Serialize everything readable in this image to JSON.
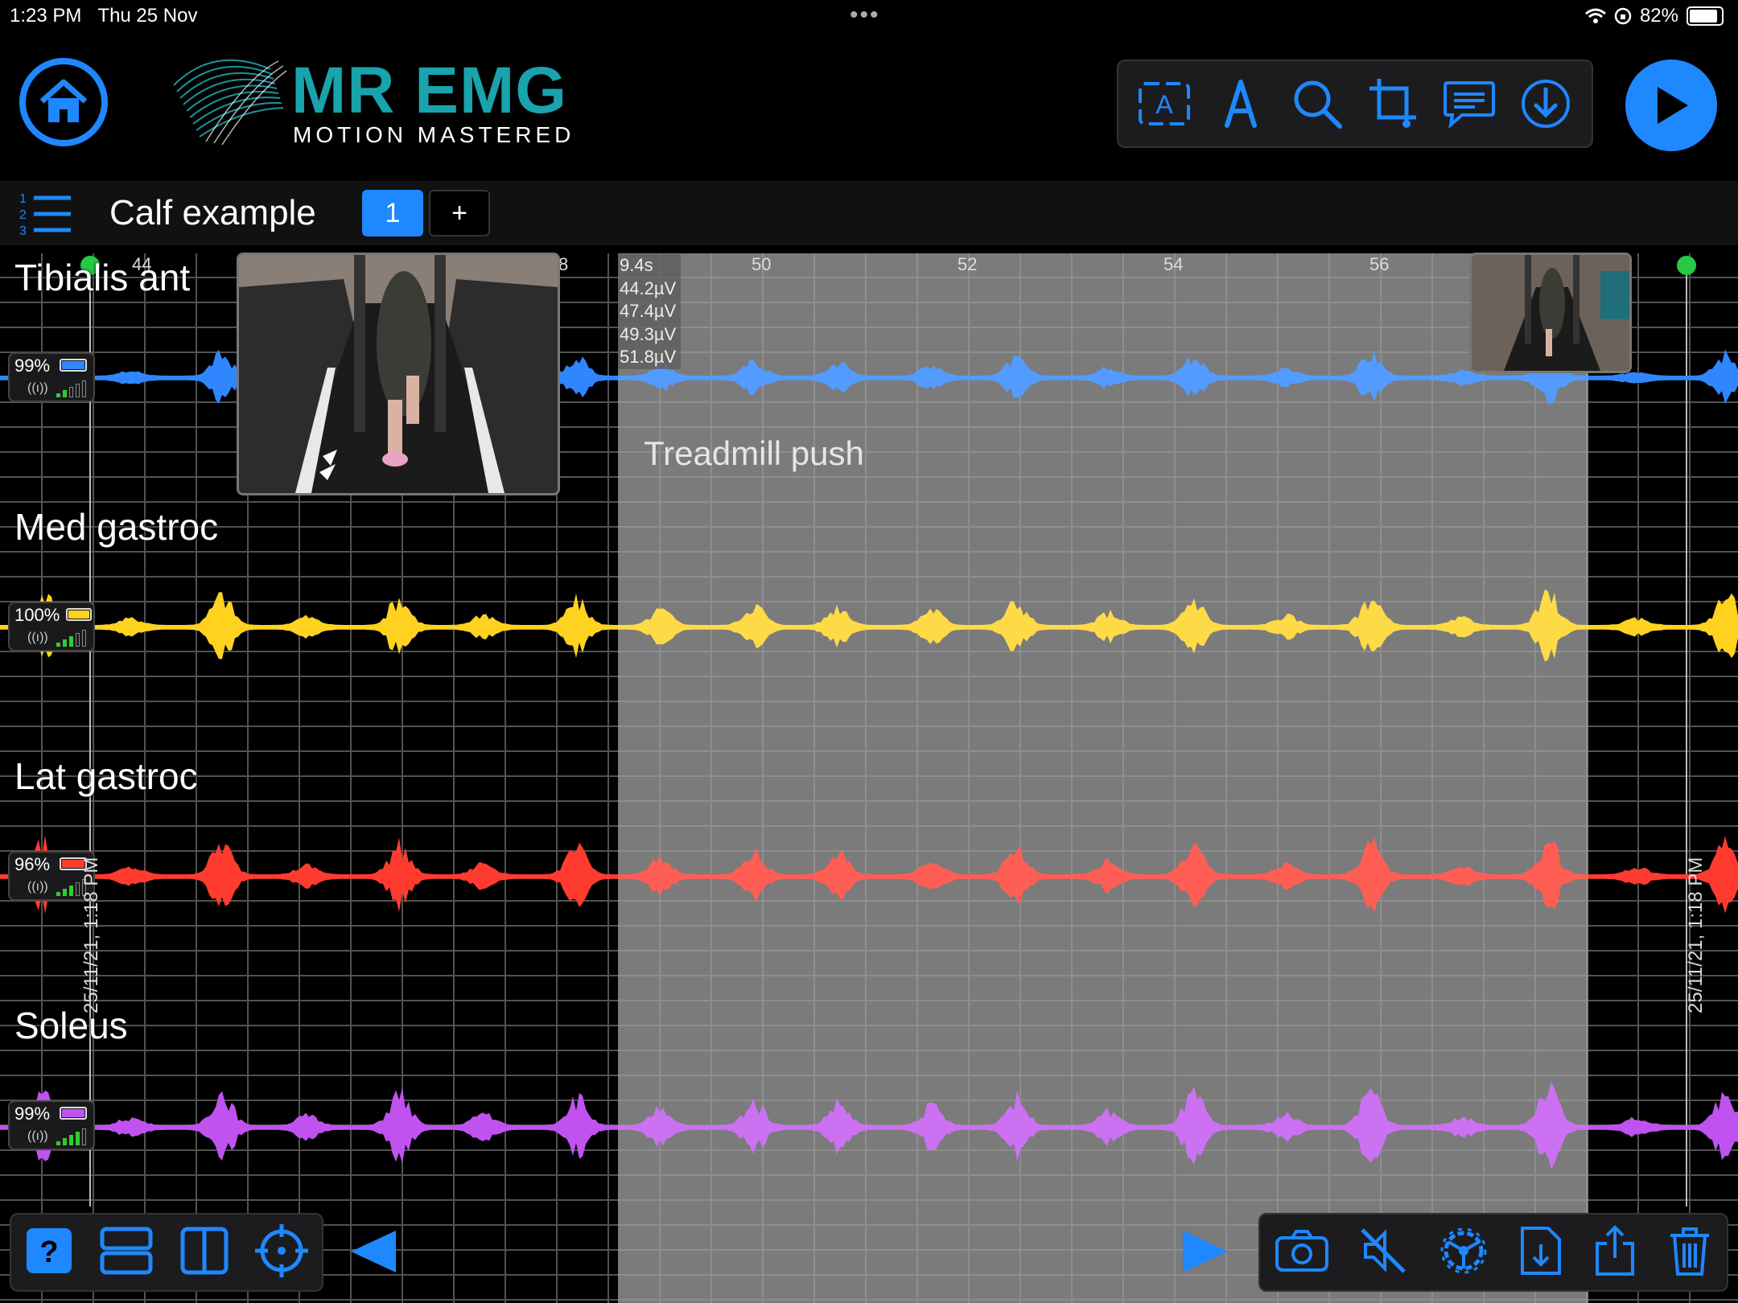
{
  "status_bar": {
    "time": "1:23 PM",
    "date": "Thu 25 Nov",
    "battery": "82%",
    "icons": [
      "wifi-icon",
      "orientation-lock-icon",
      "battery-icon"
    ]
  },
  "header": {
    "brand_title": "MR EMG",
    "brand_subtitle": "MOTION MASTERED",
    "toolbar_icons": [
      "text-annotation-icon",
      "pen-icon",
      "search-icon",
      "crop-icon",
      "comment-icon",
      "download-icon"
    ],
    "home_icon": "home-icon",
    "play_icon": "play-icon"
  },
  "session": {
    "title": "Calf example",
    "active_tab": "1",
    "add_tab": "+"
  },
  "timeline": {
    "ticks": [
      "44",
      "8",
      "50",
      "52",
      "54",
      "56"
    ],
    "selection_readout": [
      "9.4s",
      "44.2µV",
      "47.4µV",
      "49.3µV",
      "51.8µV"
    ],
    "annotation": "Treadmill push",
    "start_date": "25/11/21, 1:18 PM",
    "end_date": "25/11/21, 1:18 PM"
  },
  "channels": [
    {
      "name": "Tibialis ant",
      "battery": "99%",
      "color": "#2f86ff"
    },
    {
      "name": "Med gastroc",
      "battery": "100%",
      "color": "#ffd21f"
    },
    {
      "name": "Lat gastroc",
      "battery": "96%",
      "color": "#ff3b30"
    },
    {
      "name": "Soleus",
      "battery": "99%",
      "color": "#c052f0"
    }
  ],
  "bottom_toolbar": {
    "left_icons": [
      "help-icon",
      "split-horizontal-icon",
      "split-vertical-icon",
      "crosshair-icon"
    ],
    "right_icons": [
      "camera-icon",
      "mute-icon",
      "settings-icon",
      "import-file-icon",
      "share-icon",
      "trash-icon"
    ],
    "prev_icon": "previous-icon",
    "next_icon": "next-icon"
  }
}
